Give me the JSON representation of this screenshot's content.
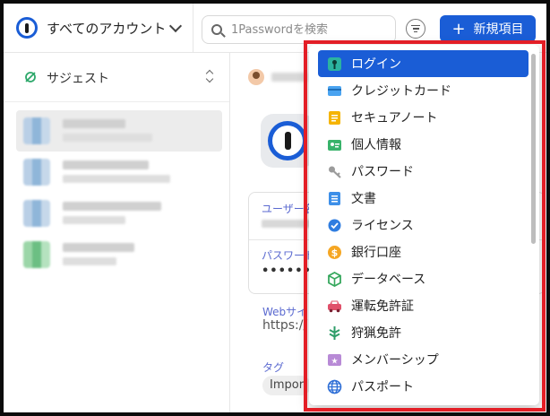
{
  "topbar": {
    "account_label": "すべてのアカウント",
    "search_placeholder": "1Passwordを検索",
    "new_item_label": "新規項目",
    "accent_color": "#1a5dd6"
  },
  "sidebar": {
    "suggest_label": "サジェスト"
  },
  "detail": {
    "username_label": "ユーザー名",
    "password_label": "パスワード",
    "password_value": "••••••••",
    "website_label": "Webサイト",
    "website_value": "https://",
    "tag_label": "タグ",
    "tag_value": "Impor"
  },
  "dropdown": {
    "items": [
      {
        "label": "ログイン",
        "icon": "key-icon",
        "active": true
      },
      {
        "label": "クレジットカード",
        "icon": "credit-card-icon"
      },
      {
        "label": "セキュアノート",
        "icon": "note-icon"
      },
      {
        "label": "個人情報",
        "icon": "id-icon"
      },
      {
        "label": "パスワード",
        "icon": "password-key-icon"
      },
      {
        "label": "文書",
        "icon": "document-icon"
      },
      {
        "label": "ライセンス",
        "icon": "license-icon"
      },
      {
        "label": "銀行口座",
        "icon": "bank-icon"
      },
      {
        "label": "データベース",
        "icon": "database-icon"
      },
      {
        "label": "運転免許証",
        "icon": "car-icon"
      },
      {
        "label": "狩猟免許",
        "icon": "tree-icon"
      },
      {
        "label": "メンバーシップ",
        "icon": "membership-icon"
      },
      {
        "label": "パスポート",
        "icon": "globe-icon"
      }
    ]
  },
  "highlight_color": "#e31e26"
}
